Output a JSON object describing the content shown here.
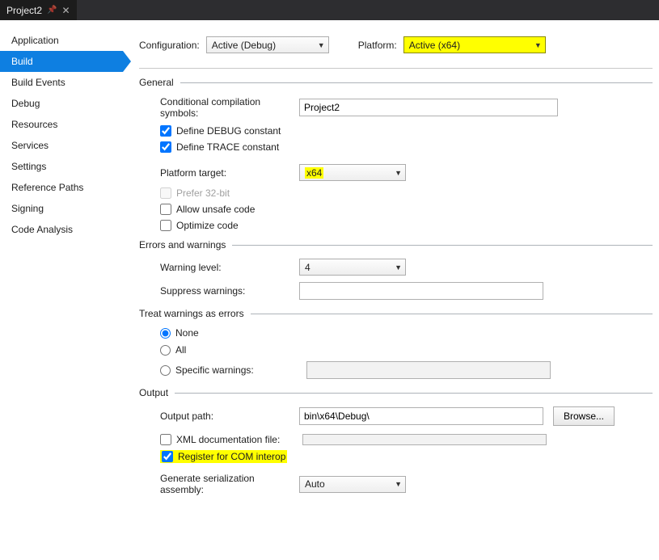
{
  "tab": {
    "title": "Project2"
  },
  "sidebar": {
    "items": [
      {
        "label": "Application"
      },
      {
        "label": "Build"
      },
      {
        "label": "Build Events"
      },
      {
        "label": "Debug"
      },
      {
        "label": "Resources"
      },
      {
        "label": "Services"
      },
      {
        "label": "Settings"
      },
      {
        "label": "Reference Paths"
      },
      {
        "label": "Signing"
      },
      {
        "label": "Code Analysis"
      }
    ]
  },
  "top": {
    "configuration_label": "Configuration:",
    "configuration_value": "Active (Debug)",
    "platform_label": "Platform:",
    "platform_value": "Active (x64)"
  },
  "general": {
    "head": "General",
    "cond_sym_label": "Conditional compilation symbols:",
    "cond_sym_value": "Project2",
    "define_debug": "Define DEBUG constant",
    "define_trace": "Define TRACE constant",
    "platform_target_label": "Platform target:",
    "platform_target_value": "x64",
    "prefer_32": "Prefer 32-bit",
    "allow_unsafe": "Allow unsafe code",
    "optimize": "Optimize code"
  },
  "errors": {
    "head": "Errors and warnings",
    "warning_level_label": "Warning level:",
    "warning_level_value": "4",
    "suppress_label": "Suppress warnings:",
    "suppress_value": ""
  },
  "treat": {
    "head": "Treat warnings as errors",
    "none": "None",
    "all": "All",
    "specific": "Specific warnings:",
    "specific_value": ""
  },
  "output": {
    "head": "Output",
    "path_label": "Output path:",
    "path_value": "bin\\x64\\Debug\\",
    "browse": "Browse...",
    "xml_doc": "XML documentation file:",
    "xml_doc_value": "",
    "register_com": "Register for COM interop",
    "gen_serial_label": "Generate serialization assembly:",
    "gen_serial_value": "Auto"
  }
}
